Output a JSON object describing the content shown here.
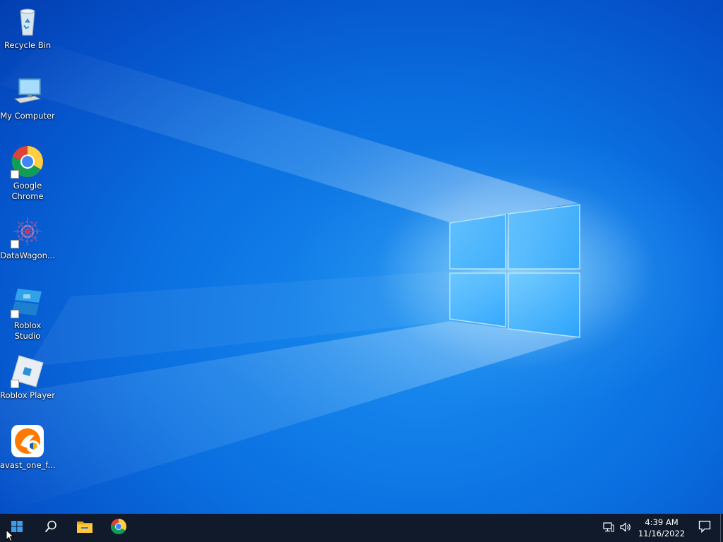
{
  "desktop": {
    "icons": [
      {
        "label": "Recycle Bin",
        "icon": "recycle-bin-icon"
      },
      {
        "label": "My Computer",
        "icon": "computer-icon"
      },
      {
        "label": "Google Chrome",
        "icon": "chrome-icon"
      },
      {
        "label": "DataWagon...",
        "icon": "datawagon-icon"
      },
      {
        "label": "Roblox Studio",
        "icon": "roblox-studio-icon"
      },
      {
        "label": "Roblox Player",
        "icon": "roblox-player-icon"
      },
      {
        "label": "avast_one_f...",
        "icon": "avast-icon"
      }
    ]
  },
  "taskbar": {
    "start": {
      "icon": "windows-start-icon"
    },
    "search": {
      "icon": "search-icon"
    },
    "pinned": [
      {
        "icon": "file-explorer-icon"
      },
      {
        "icon": "chrome-icon"
      }
    ],
    "tray": {
      "network_icon": "network-icon",
      "volume_icon": "volume-icon",
      "time": "4:39 AM",
      "date": "11/16/2022",
      "notification_icon": "action-center-icon"
    }
  },
  "colors": {
    "taskbar_bg": "#101a2a",
    "desktop_blue": "#0a6fe0",
    "window_logo": "#8fd4ff"
  }
}
